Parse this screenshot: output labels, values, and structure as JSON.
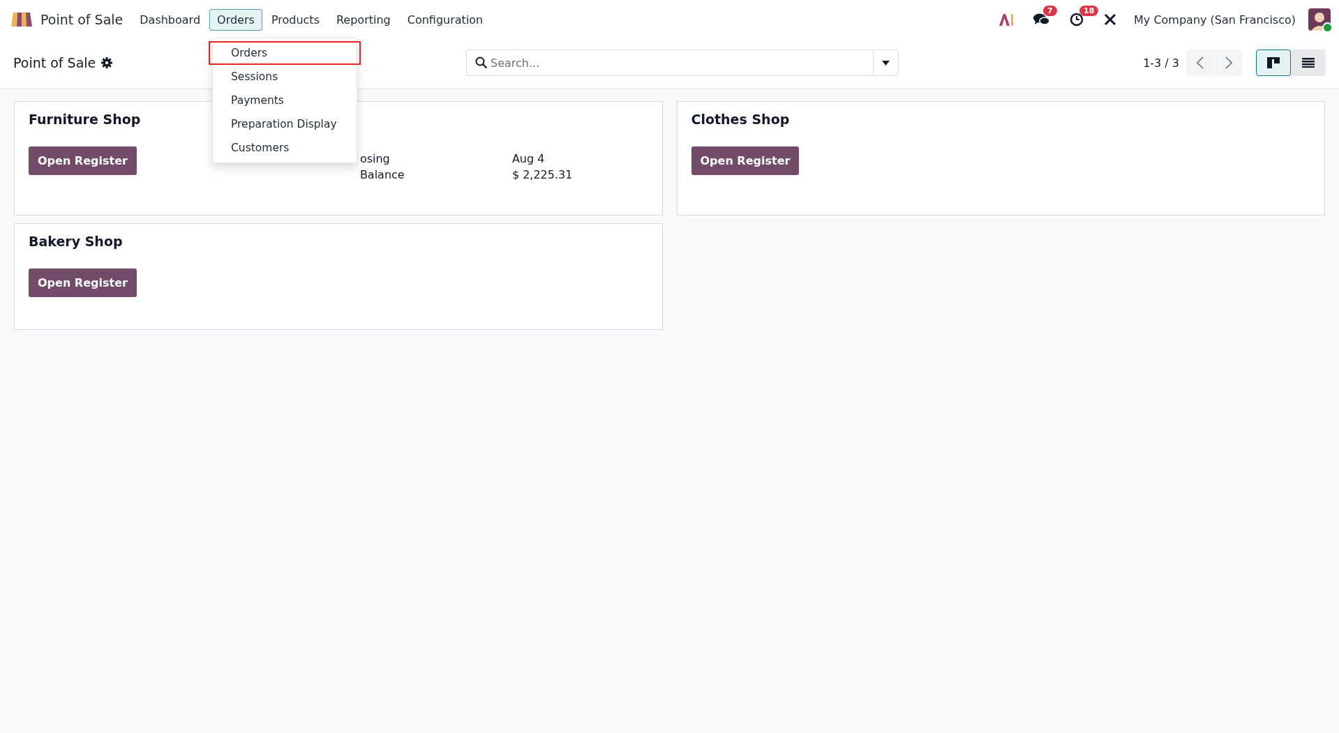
{
  "navbar": {
    "app_name": "Point of Sale",
    "menu": [
      {
        "label": "Dashboard",
        "selected": false
      },
      {
        "label": "Orders",
        "selected": true
      },
      {
        "label": "Products",
        "selected": false
      },
      {
        "label": "Reporting",
        "selected": false
      },
      {
        "label": "Configuration",
        "selected": false
      }
    ],
    "dropdown": [
      {
        "label": "Orders",
        "highlighted": true
      },
      {
        "label": "Sessions",
        "highlighted": false
      },
      {
        "label": "Payments",
        "highlighted": false
      },
      {
        "label": "Preparation Display",
        "highlighted": false
      },
      {
        "label": "Customers",
        "highlighted": false
      }
    ],
    "messages_badge": "7",
    "activities_badge": "18",
    "company": "My Company (San Francisco)"
  },
  "control_panel": {
    "title": "Point of Sale",
    "search": {
      "placeholder": "Search..."
    },
    "pager": "1-3 / 3",
    "views": [
      {
        "kind": "kanban",
        "selected": true
      },
      {
        "kind": "list",
        "selected": false
      }
    ]
  },
  "cards": [
    {
      "name": "Furniture Shop",
      "button": "Open Register",
      "stats": [
        {
          "label": "osing",
          "value": "Aug 4"
        },
        {
          "label": "Balance",
          "value": "$ 2,225.31"
        }
      ]
    },
    {
      "name": "Clothes Shop",
      "button": "Open Register"
    },
    {
      "name": "Bakery Shop",
      "button": "Open Register"
    }
  ]
}
